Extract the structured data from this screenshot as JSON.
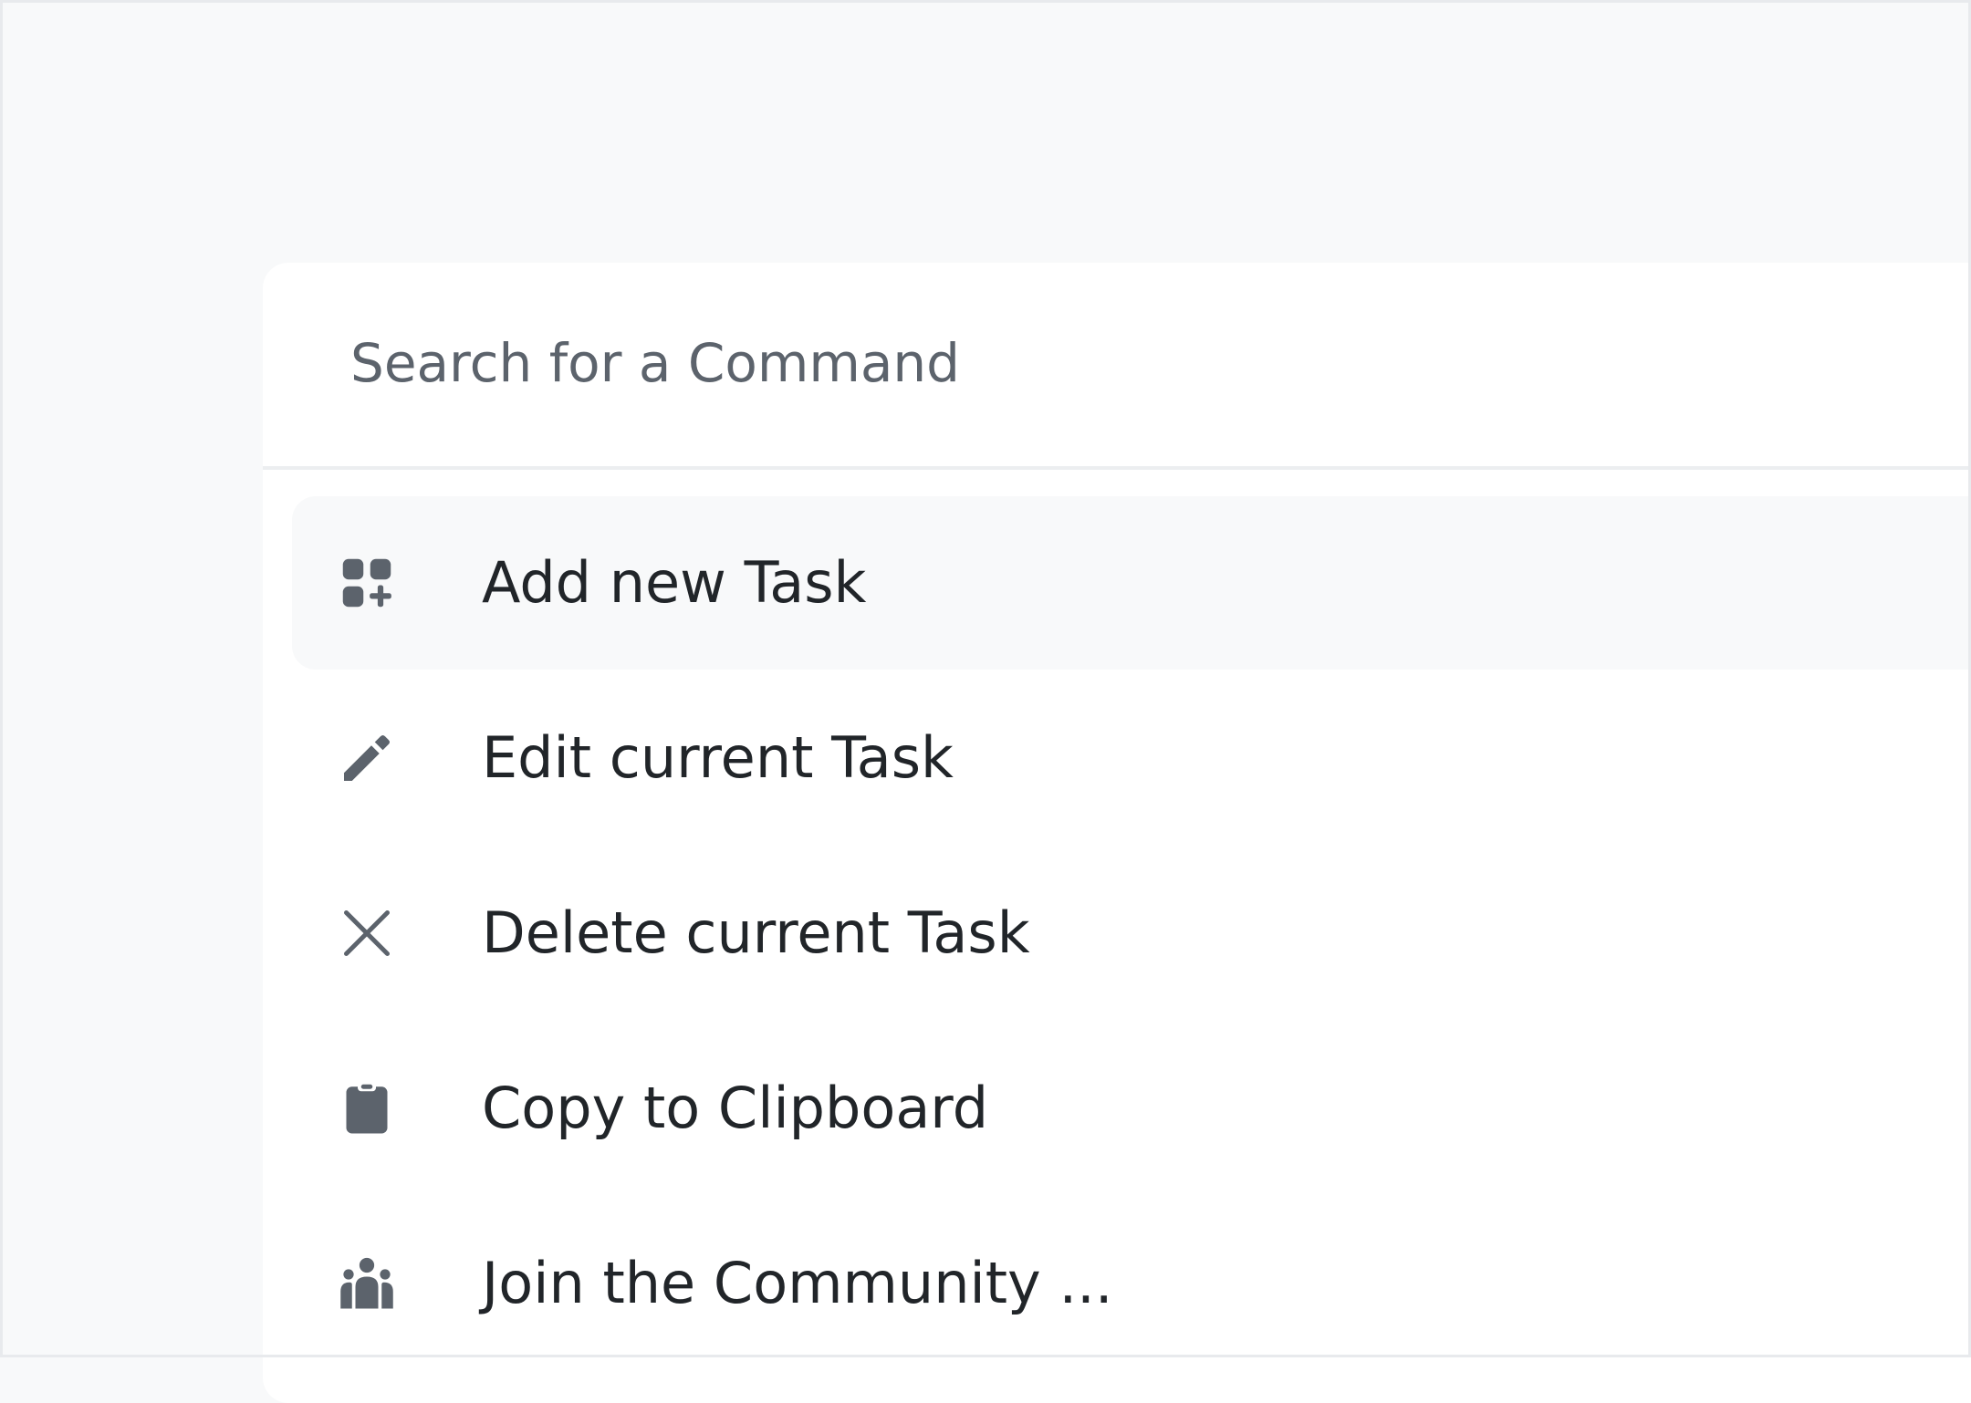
{
  "search": {
    "placeholder": "Search for a Command"
  },
  "colors": {
    "background": "#f8f9fa",
    "panel": "#ffffff",
    "active_item": "#f8f9fa",
    "icon": "#5c636c",
    "text": "#212529"
  },
  "commands": [
    {
      "label": "Add new Task",
      "icon": "apps-add-icon",
      "active": true
    },
    {
      "label": "Edit current Task",
      "icon": "pencil-icon",
      "active": false
    },
    {
      "label": "Delete current Task",
      "icon": "close-icon",
      "active": false
    },
    {
      "label": "Copy to Clipboard",
      "icon": "clipboard-icon",
      "active": false
    },
    {
      "label": "Join the Community ...",
      "icon": "community-icon",
      "active": false
    }
  ]
}
